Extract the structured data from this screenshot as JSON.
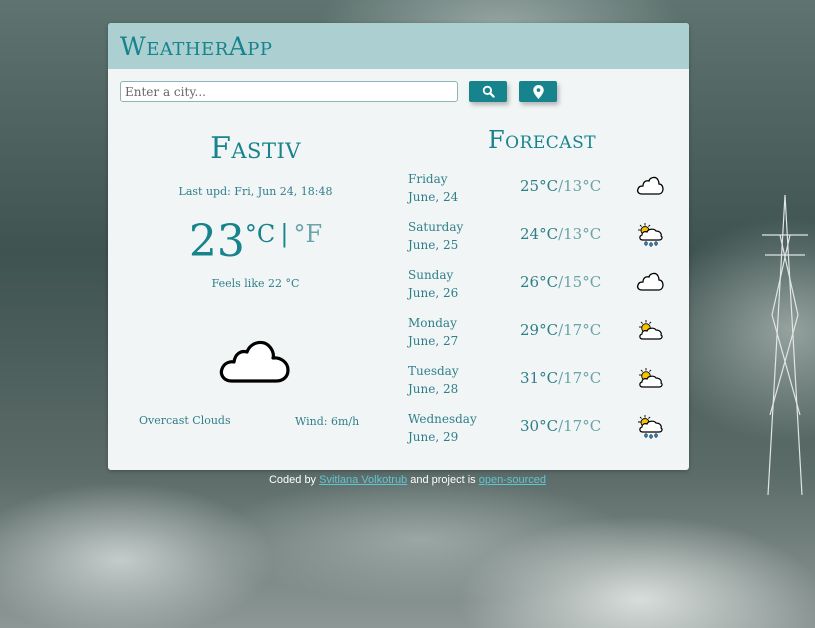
{
  "app": {
    "title": "WeatherApp"
  },
  "search": {
    "placeholder": "Enter a city...",
    "value": ""
  },
  "buttons": {
    "search_icon": "search-icon",
    "location_icon": "location-pin-icon"
  },
  "current": {
    "city": "Fastiv",
    "last_updated": "Last upd: Fri, Jun 24, 18:48",
    "temperature": "23",
    "unit_c": "°C",
    "unit_sep": "|",
    "unit_f": "°F",
    "feels_like": "Feels like 22 °C",
    "icon": "cloud-icon",
    "description": "Overcast Clouds",
    "wind": "Wind: 6m/h"
  },
  "forecast": {
    "title": "Forecast",
    "days": [
      {
        "day": "Friday",
        "date": "June, 24",
        "max": "25°C",
        "sep": "/",
        "min": "13°C",
        "icon": "cloud-icon"
      },
      {
        "day": "Saturday",
        "date": "June, 25",
        "max": "24°C",
        "sep": "/",
        "min": "13°C",
        "icon": "sun-rain-cloud-icon"
      },
      {
        "day": "Sunday",
        "date": "June, 26",
        "max": "26°C",
        "sep": "/",
        "min": "15°C",
        "icon": "cloud-icon"
      },
      {
        "day": "Monday",
        "date": "June, 27",
        "max": "29°C",
        "sep": "/",
        "min": "17°C",
        "icon": "partly-cloudy-icon"
      },
      {
        "day": "Tuesday",
        "date": "June, 28",
        "max": "31°C",
        "sep": "/",
        "min": "17°C",
        "icon": "partly-cloudy-icon"
      },
      {
        "day": "Wednesday",
        "date": "June, 29",
        "max": "30°C",
        "sep": "/",
        "min": "17°C",
        "icon": "sun-rain-cloud-icon"
      }
    ]
  },
  "footer": {
    "prefix": "Coded by ",
    "author": "Svitlana Volkotrub",
    "middle": " and project is ",
    "link": "open-sourced"
  },
  "colors": {
    "accent": "#17838c",
    "header_bg": "#acd0d1",
    "card_bg": "#f2f5f5",
    "link": "#5fc6d1"
  }
}
